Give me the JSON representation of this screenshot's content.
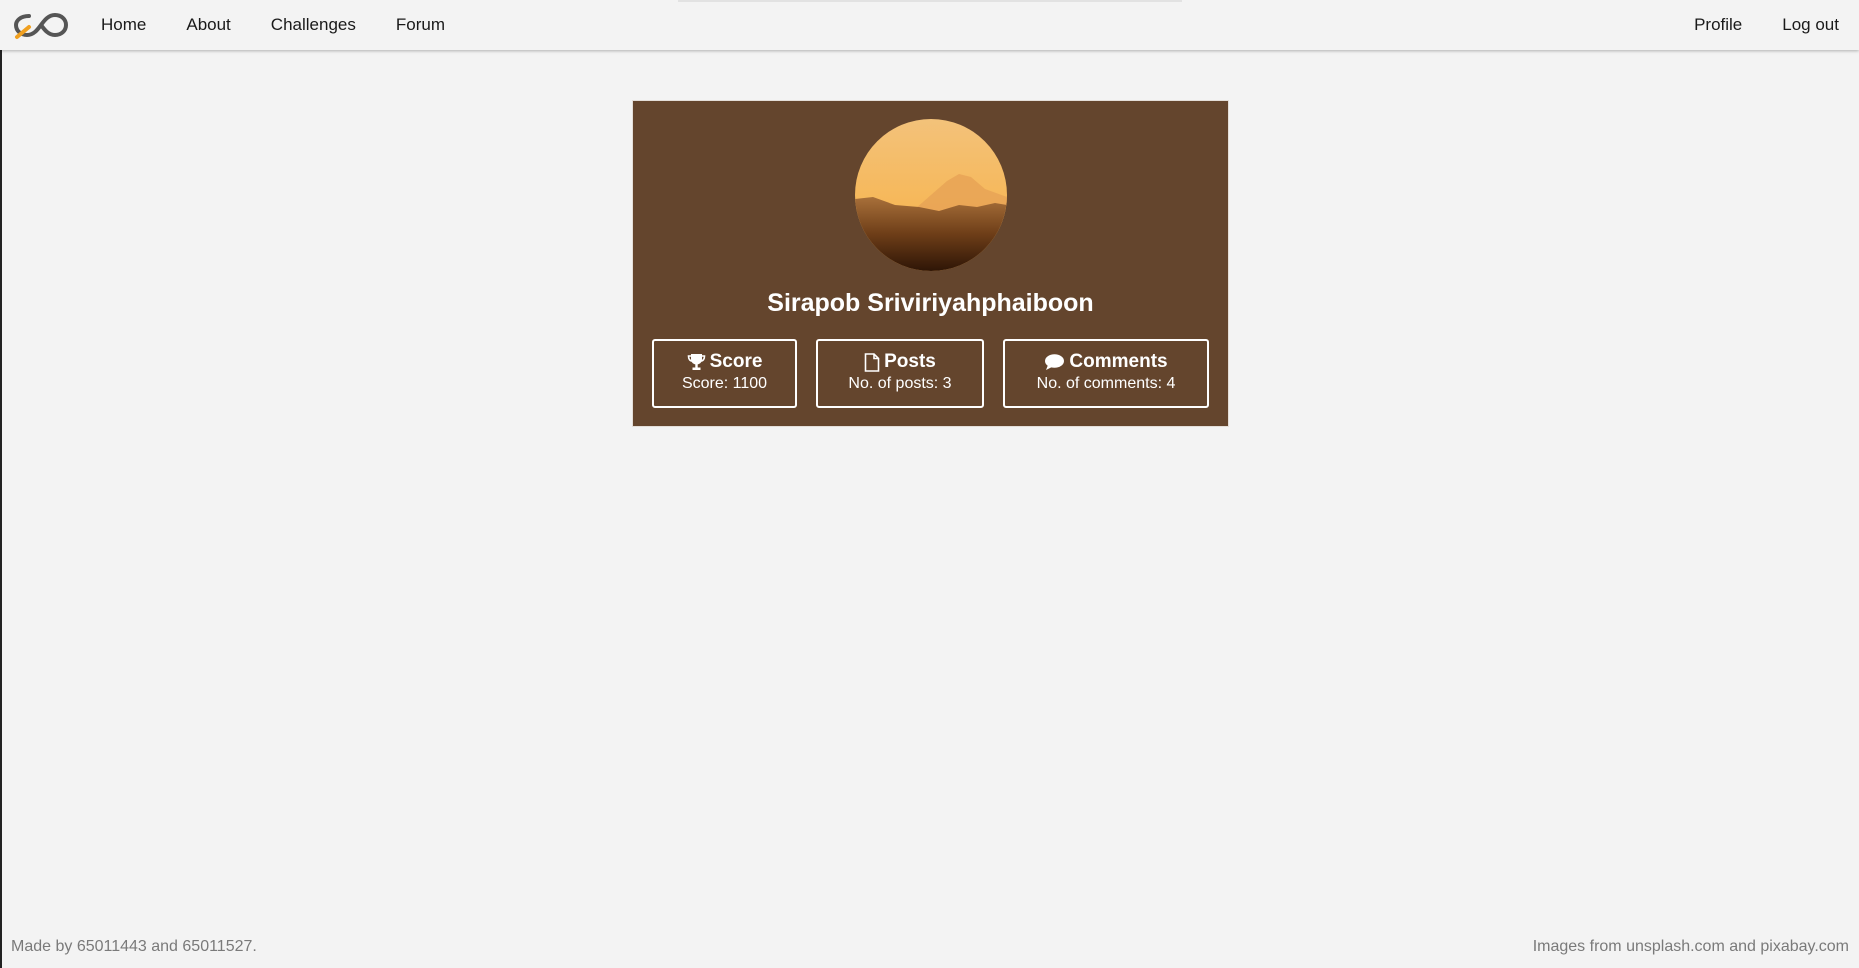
{
  "nav": {
    "left": [
      "Home",
      "About",
      "Challenges",
      "Forum"
    ],
    "right": [
      "Profile",
      "Log out"
    ],
    "logo_icon": "infinity-logo-icon"
  },
  "profile": {
    "name": "Sirapob Sriviriyahphaiboon",
    "avatar": "mountain-sunset-image",
    "card_color": "#64452d",
    "stats": [
      {
        "icon": "trophy-icon",
        "title": "Score",
        "value": "Score: 1100"
      },
      {
        "icon": "file-icon",
        "title": "Posts",
        "value": "No. of posts: 3"
      },
      {
        "icon": "comment-icon",
        "title": "Comments",
        "value": "No. of comments: 4"
      }
    ]
  },
  "footer": {
    "left": "Made by 65011443 and 65011527.",
    "right": "Images from unsplash.com and pixabay.com"
  }
}
